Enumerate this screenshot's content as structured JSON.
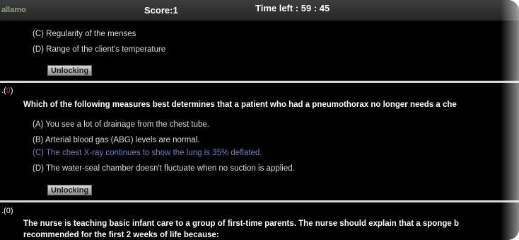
{
  "header": {
    "app_name": "allamo",
    "score": "Score:1",
    "time_left": "Time left : 59 : 45"
  },
  "prev_question": {
    "options": [
      "(C) Regularity of the menses",
      "(D) Range of the client's temperature"
    ],
    "button_label": "Unlocking"
  },
  "question_2": {
    "prefix": ".(",
    "number": "0",
    "suffix": ")",
    "text": "Which of the following measures best determines that a patient who had a pneumothorax no longer needs a che",
    "options": [
      "(A) You see a lot of drainage from the chest tube.",
      "(B) Arterial blood gas (ABG) levels are normal.",
      "(C) The chest X-ray continues to show the lung is 35% deflated.",
      "(D) The water-seal chamber doesn't fluctuate when no suction is applied."
    ],
    "selected_option": "(C)",
    "button_label": "Unlocking"
  },
  "question_3": {
    "number_label": ".(0)",
    "text_line1": "The nurse is teaching basic infant care to a group of first-time parents. The nurse should explain that a sponge b",
    "text_line2": "recommended for the first 2 weeks of life because:"
  }
}
